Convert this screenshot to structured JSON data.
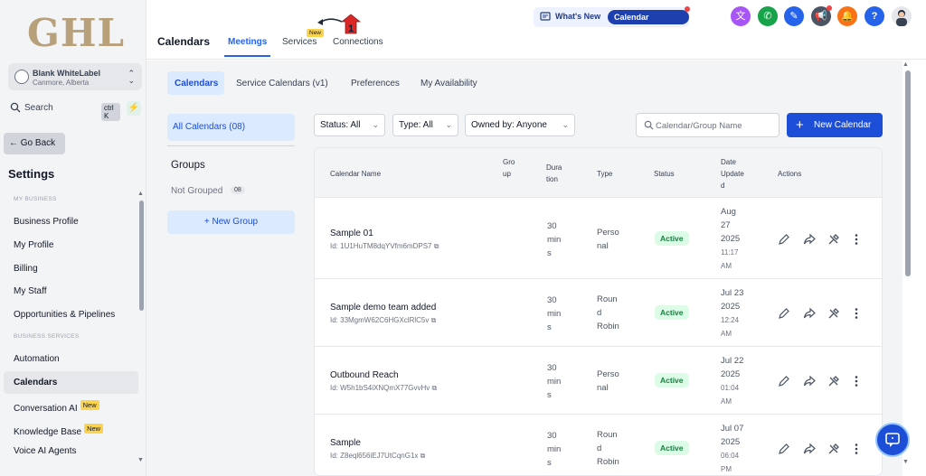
{
  "sidebar": {
    "logo": "GHL",
    "account": {
      "name": "Blank WhiteLabel",
      "location": "Canmore, Alberta"
    },
    "search": {
      "label": "Search",
      "shortcut": "ctrl K"
    },
    "go_back": "Go Back",
    "settings_title": "Settings",
    "section_business": "MY BUSINESS",
    "business_items": [
      "Business Profile",
      "My Profile",
      "Billing",
      "My Staff",
      "Opportunities & Pipelines"
    ],
    "section_services": "BUSINESS SERVICES",
    "service_items": [
      "Automation",
      "Calendars",
      "Conversation AI",
      "Knowledge Base",
      "Voice AI Agents"
    ],
    "new_badge": "New"
  },
  "header": {
    "title": "Calendars",
    "tabs": [
      "Meetings",
      "Services",
      "Connections"
    ],
    "active_tab": "Meetings",
    "services_badge": "New",
    "annotation_number": "1",
    "whats_new": "What's New",
    "calendar_updates": "Calendar Updates",
    "icons": [
      "translate-icon",
      "phone-icon",
      "megaphone-icon",
      "bell-icon",
      "help-icon"
    ],
    "colors": {
      "translate": "#a855f7",
      "phone": "#16a34a",
      "ticket": "#2563eb",
      "megaphone": "#4b5563",
      "bell": "#f97316",
      "help": "#2563eb"
    }
  },
  "content": {
    "tabs": [
      "Calendars",
      "Service Calendars (v1)",
      "Preferences",
      "My Availability"
    ],
    "active_tab": "Calendars",
    "left_panel": {
      "all_calendars": "All Calendars (08)",
      "groups_title": "Groups",
      "not_grouped": "Not Grouped",
      "not_grouped_count": "08",
      "new_group": "New Group"
    },
    "filters": {
      "status": "Status: All",
      "type": "Type: All",
      "owned_by": "Owned by: Anyone",
      "search_placeholder": "Calendar/Group Name",
      "new_calendar": "New Calendar"
    },
    "table": {
      "headers": {
        "name": "Calendar Name",
        "group": [
          "Gro",
          "up"
        ],
        "duration": [
          "Dura",
          "tion"
        ],
        "type": "Type",
        "status": "Status",
        "date": [
          "Date",
          "Update",
          "d"
        ],
        "actions": "Actions"
      },
      "rows": [
        {
          "name": "Sample 01",
          "id": "Id: 1U1HuTM8dqYVfm6mDPS7",
          "duration": [
            "30",
            "min",
            "s"
          ],
          "type": [
            "Perso",
            "nal"
          ],
          "status": "Active",
          "date": [
            "Aug",
            "27",
            "2025"
          ],
          "time": [
            "11:17",
            "AM"
          ]
        },
        {
          "name": "Sample demo team added",
          "id": "Id: 33MgmW62C6HGXclRlC5v",
          "duration": [
            "30",
            "min",
            "s"
          ],
          "type": [
            "Roun",
            "d",
            "Robin"
          ],
          "status": "Active",
          "date": [
            "Jul 23",
            "2025"
          ],
          "time": [
            "12:24",
            "AM"
          ]
        },
        {
          "name": "Outbound Reach",
          "id": "Id: W5h1bS4iXNQmX77GvvHv",
          "duration": [
            "30",
            "min",
            "s"
          ],
          "type": [
            "Perso",
            "nal"
          ],
          "status": "Active",
          "date": [
            "Jul 22",
            "2025"
          ],
          "time": [
            "01:04",
            "AM"
          ]
        },
        {
          "name": "Sample",
          "id": "Id: Z8eql656iEJ7UtCqnG1x",
          "duration": [
            "30",
            "min",
            "s"
          ],
          "type": [
            "Roun",
            "d",
            "Robin"
          ],
          "status": "Active",
          "date": [
            "Jul 07",
            "2025"
          ],
          "time": [
            "06:04",
            "PM"
          ]
        }
      ]
    }
  }
}
